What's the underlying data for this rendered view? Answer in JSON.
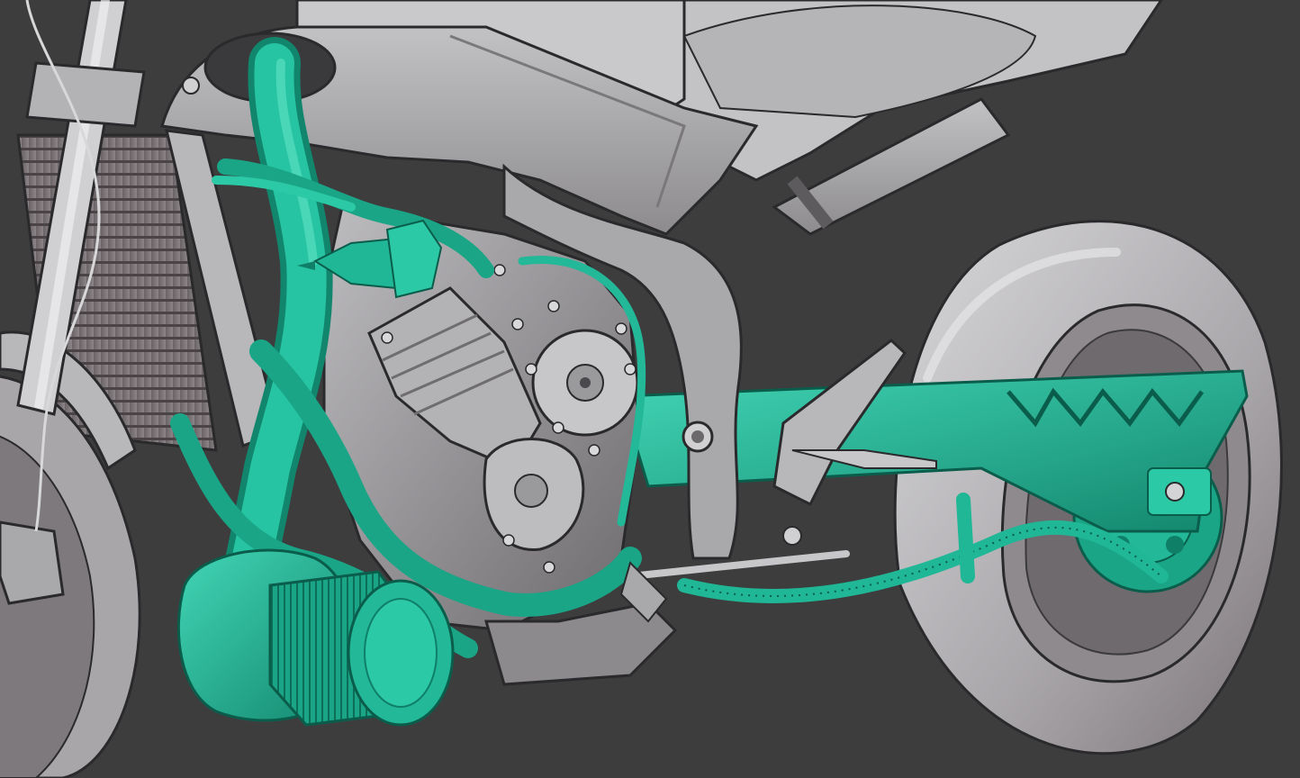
{
  "scene": {
    "subject": "motorcycle-3d-render",
    "colors": {
      "background": "#3d3d3e",
      "gray_light": "#c9c9cb",
      "gray_mid": "#9d9da0",
      "gray_dark": "#6e6e72",
      "gray_shadow": "#4a4a4e",
      "teal": "#1fb796",
      "teal_light": "#3fd1b1",
      "teal_dark": "#0f7f67",
      "outline": "#2a2a2c"
    }
  }
}
